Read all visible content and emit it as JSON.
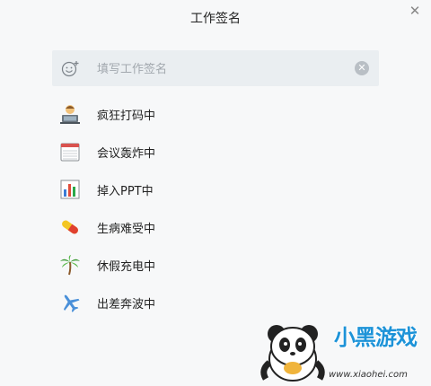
{
  "dialog": {
    "title": "工作签名",
    "close_icon": "close-icon"
  },
  "search": {
    "placeholder": "填写工作签名",
    "value": "",
    "emoji_icon": "emoji-add-icon",
    "clear_icon": "clear-icon"
  },
  "statuses": [
    {
      "label": "疯狂打码中",
      "icon": "coder-laptop-icon"
    },
    {
      "label": "会议轰炸中",
      "icon": "calendar-icon"
    },
    {
      "label": "掉入PPT中",
      "icon": "bar-chart-icon"
    },
    {
      "label": "生病难受中",
      "icon": "pill-icon"
    },
    {
      "label": "休假充电中",
      "icon": "palm-tree-icon"
    },
    {
      "label": "出差奔波中",
      "icon": "airplane-icon"
    }
  ],
  "watermark": {
    "logo": "小黑游戏",
    "url": "www.xiaohei.com"
  }
}
